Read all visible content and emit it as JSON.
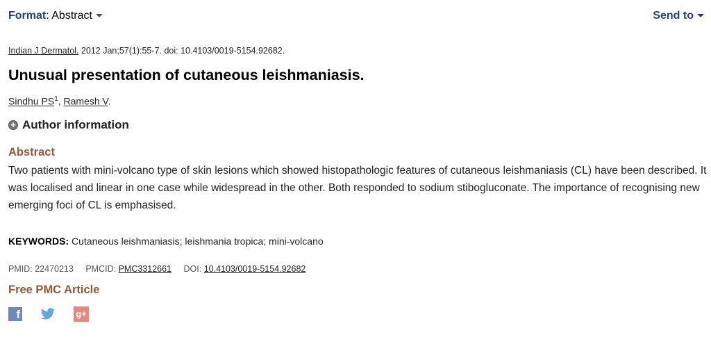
{
  "format": {
    "label": "Format",
    "colon": ":",
    "value": "Abstract"
  },
  "send_to": {
    "label": "Send to"
  },
  "citation": {
    "journal": "Indian J Dermatol.",
    "details": "2012 Jan;57(1):55-7. doi: 10.4103/0019-5154.92682."
  },
  "article": {
    "title": "Unusual presentation of cutaneous leishmaniasis."
  },
  "authors": [
    {
      "name": "Sindhu PS",
      "sup": "1"
    },
    {
      "name": "Ramesh V"
    }
  ],
  "author_sep": ",",
  "author_end": ".",
  "author_info": {
    "label": "Author information"
  },
  "abstract": {
    "heading": "Abstract",
    "text": "Two patients with mini-volcano type of skin lesions which showed histopathologic features of cutaneous leishmaniasis (CL) have been described. It was localised and linear in one case while widespread in the other. Both responded to sodium stibogluconate. The importance of recognising new emerging foci of CL is emphasised."
  },
  "keywords": {
    "label": "KEYWORDS:",
    "value": "Cutaneous leishmaniasis; leishmania tropica; mini-volcano"
  },
  "ids": {
    "pmid_label": "PMID:",
    "pmid": "22470213",
    "pmcid_label": "PMCID:",
    "pmcid": "PMC3312661",
    "doi_label": "DOI:",
    "doi": "10.4103/0019-5154.92682"
  },
  "free_pmc": "Free PMC Article",
  "social": {
    "facebook_glyph": "f",
    "googleplus_glyph": "g+",
    "icons": [
      "facebook-icon",
      "twitter-icon",
      "google-plus-icon"
    ]
  },
  "colors": {
    "nav_blue": "#264077",
    "heading_brown": "#985735"
  }
}
